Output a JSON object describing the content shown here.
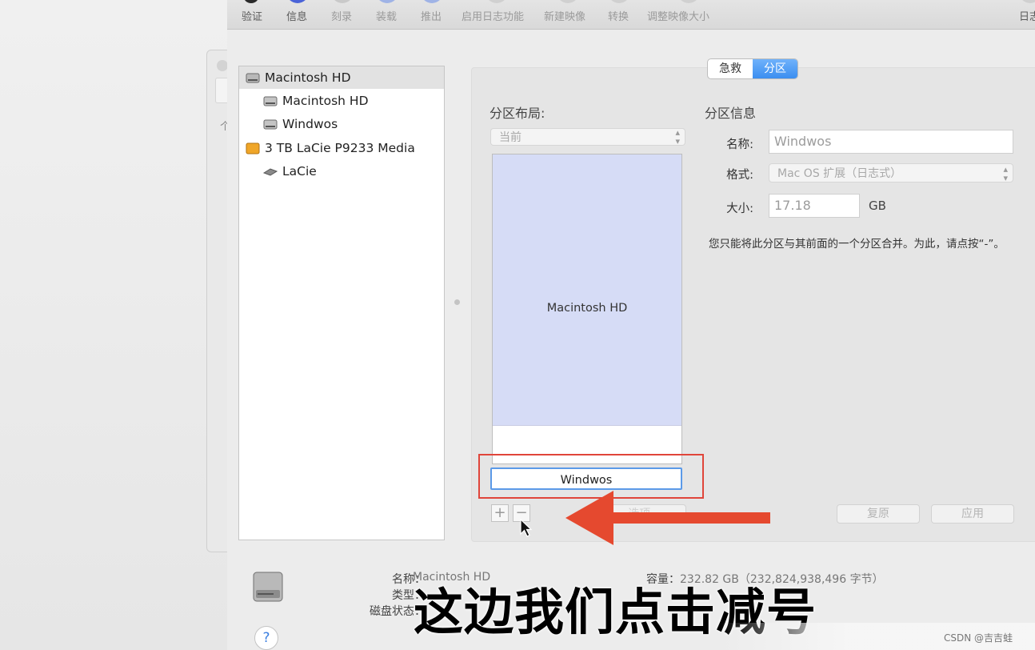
{
  "toolbar": {
    "items": [
      {
        "label": "验证",
        "icon": "verify-icon",
        "dim": false
      },
      {
        "label": "信息",
        "icon": "info-icon",
        "dim": false
      },
      {
        "label": "刻录",
        "icon": "burn-icon",
        "dim": true
      },
      {
        "label": "装载",
        "icon": "mount-icon",
        "dim": true
      },
      {
        "label": "推出",
        "icon": "eject-icon",
        "dim": true
      },
      {
        "label": "启用日志功能",
        "icon": "journal-icon",
        "dim": true
      },
      {
        "label": "新建映像",
        "icon": "new-image-icon",
        "dim": true
      },
      {
        "label": "转换",
        "icon": "convert-icon",
        "dim": true
      },
      {
        "label": "调整映像大小",
        "icon": "resize-image-icon",
        "dim": true
      },
      {
        "label": "日志",
        "icon": "log-icon",
        "dim": false
      }
    ]
  },
  "background_window": {
    "char": "个"
  },
  "sidebar": {
    "items": [
      {
        "label": "Macintosh HD",
        "icon": "internal-disk-icon",
        "level": 0,
        "selected": true
      },
      {
        "label": "Macintosh HD",
        "icon": "volume-icon",
        "level": 1,
        "selected": false
      },
      {
        "label": "Windwos",
        "icon": "volume-icon",
        "level": 1,
        "selected": false
      },
      {
        "label": "3 TB LaCie P9233 Media",
        "icon": "external-disk-icon",
        "level": 0,
        "selected": false
      },
      {
        "label": "LaCie",
        "icon": "external-volume-icon",
        "level": 1,
        "selected": false
      }
    ]
  },
  "tabs": {
    "first_aid": "急救",
    "partition": "分区",
    "active": "partition"
  },
  "layout_section": {
    "title": "分区布局:",
    "scheme_value": "当前",
    "partitions": [
      {
        "label": "Macintosh HD",
        "color": "#d6dcf6"
      },
      {
        "label": "Windwos",
        "color": "#ffffff",
        "selected": true
      }
    ],
    "add_label": "+",
    "remove_label": "−",
    "options_label": "选项..."
  },
  "info_section": {
    "title": "分区信息",
    "name_label": "名称:",
    "name_value": "Windwos",
    "format_label": "格式:",
    "format_value": "Mac OS 扩展（日志式）",
    "size_label": "大小:",
    "size_value": "17.18",
    "size_unit": "GB",
    "note": "您只能将此分区与其前面的一个分区合并。为此，请点按“-”。"
  },
  "buttons": {
    "revert": "复原",
    "apply": "应用"
  },
  "disk_info": {
    "name_key": "名称：",
    "name_value": "Macintosh HD",
    "type_key": "类型：",
    "status_key": "磁盘状态：",
    "capacity_key": "容量：",
    "capacity_value": "232.82 GB（232,824,938,496 字节）"
  },
  "help_label": "?",
  "overlay": {
    "subtitle": "这边我们点击减号",
    "watermark": "CSDN @吉吉蛙",
    "arrow_color": "#e5492f",
    "highlight_color": "#e0453a"
  }
}
